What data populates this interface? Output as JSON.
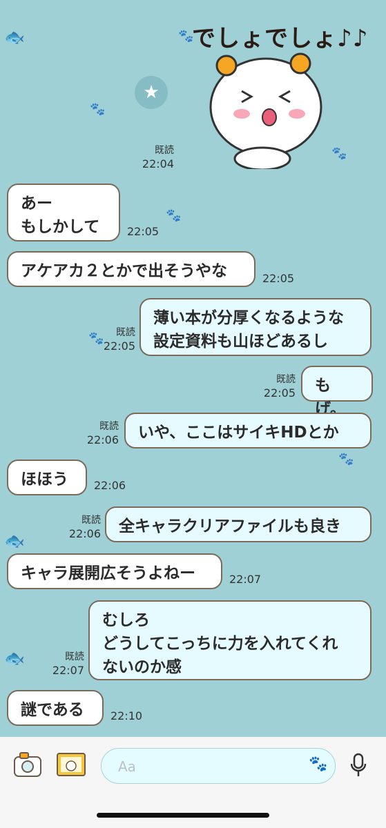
{
  "sticker": {
    "text": "でしょでしょ♪♪"
  },
  "icons": {
    "star": "★",
    "paw": "🐾",
    "mic": "mic-icon",
    "camera": "camera-icon",
    "image": "image-icon"
  },
  "messages": [
    {
      "side": "right-meta",
      "read": "既読",
      "time": "22:04"
    },
    {
      "side": "left",
      "text": "あー\nもしかして",
      "time": "22:05"
    },
    {
      "side": "left",
      "text": "アケアカ２とかで出そうやな",
      "time": "22:05"
    },
    {
      "side": "right",
      "text": "薄い本が分厚くなるような\n設定資料も山ほどあるし",
      "read": "既読",
      "time": "22:05"
    },
    {
      "side": "right",
      "text": "もげ。",
      "read": "既読",
      "time": "22:05"
    },
    {
      "side": "right",
      "text": "いや、ここはサイキHDとか",
      "read": "既読",
      "time": "22:06"
    },
    {
      "side": "left",
      "text": "ほほう",
      "time": "22:06"
    },
    {
      "side": "right",
      "text": "全キャラクリアファイルも良き",
      "read": "既読",
      "time": "22:06"
    },
    {
      "side": "left",
      "text": "キャラ展開広そうよねー",
      "time": "22:07"
    },
    {
      "side": "right",
      "text": "むしろ\nどうしてこっちに力を入れてくれ\nないのか感",
      "read": "既読",
      "time": "22:07"
    },
    {
      "side": "left",
      "text": "謎である",
      "time": "22:10"
    }
  ],
  "input": {
    "placeholder": "Aa"
  }
}
